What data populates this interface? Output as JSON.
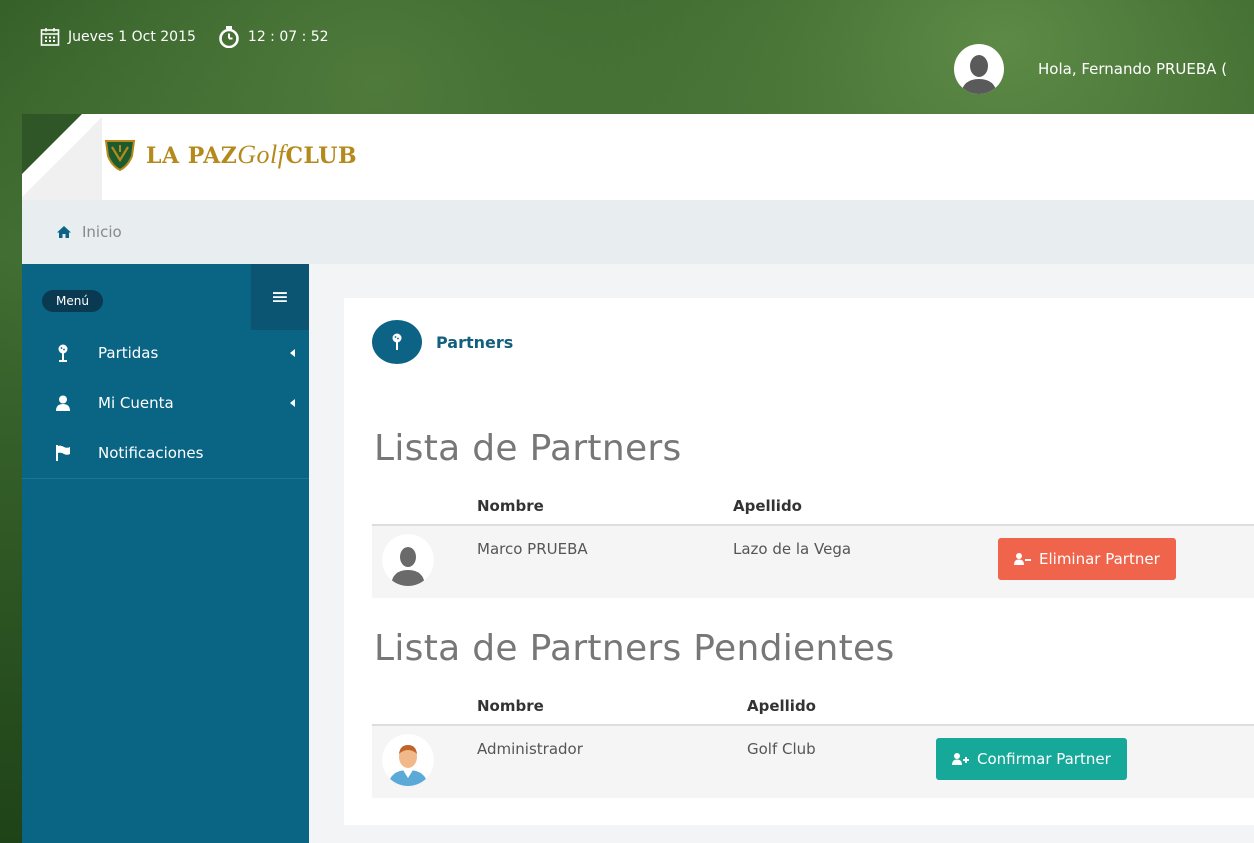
{
  "topbar": {
    "date": "Jueves 1 Oct 2015",
    "time": "12 : 07 : 52",
    "greeting": "Hola, Fernando PRUEBA ("
  },
  "header": {
    "logo_main": "LA PAZ",
    "logo_script": "Golf",
    "logo_end": "CLUB"
  },
  "breadcrumb": {
    "home": "Inicio"
  },
  "sidebar": {
    "menu_label": "Menú",
    "toggle": "≡",
    "items": [
      {
        "label": "Partidas",
        "icon": "golf-pin-icon"
      },
      {
        "label": "Mi Cuenta",
        "icon": "user-icon"
      },
      {
        "label": "Notificaciones",
        "icon": "flag-icon"
      }
    ]
  },
  "main": {
    "card_title": "Partners",
    "partners": {
      "title": "Lista de Partners",
      "col_nombre": "Nombre",
      "col_apellido": "Apellido",
      "rows": [
        {
          "nombre": "Marco PRUEBA",
          "apellido": "Lazo de la Vega",
          "action": "Eliminar Partner"
        }
      ]
    },
    "pending": {
      "title": "Lista de Partners Pendientes",
      "col_nombre": "Nombre",
      "col_apellido": "Apellido",
      "rows": [
        {
          "nombre": "Administrador",
          "apellido": "Golf Club",
          "action": "Confirmar Partner"
        }
      ]
    }
  },
  "colors": {
    "sidebar": "#0a6585",
    "accent": "#135f7d",
    "delete_button": "#f0644b",
    "confirm_button": "#16a99a",
    "logo_gold": "#b58a1c"
  }
}
